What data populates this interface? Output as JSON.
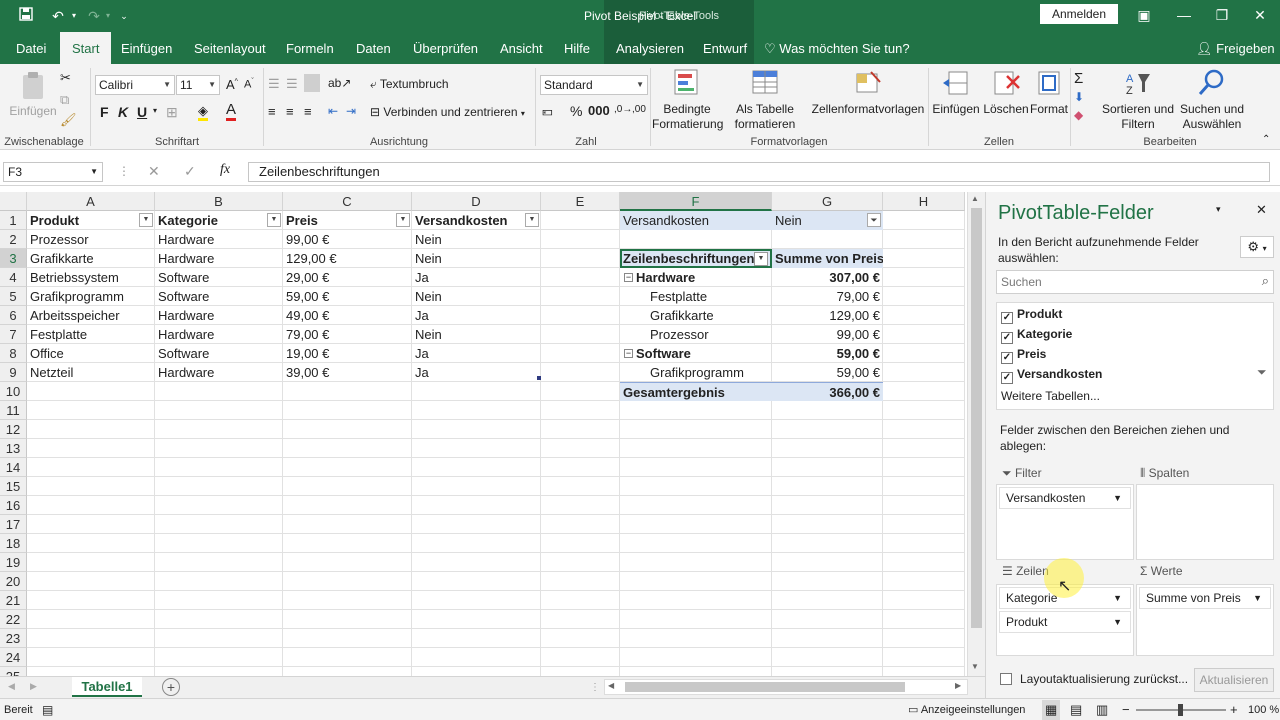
{
  "titlebar": {
    "title": "Pivot Beispiel  -  Excel",
    "context_tools": "PivotTable-Tools",
    "signin": "Anmelden"
  },
  "tabs": [
    "Datei",
    "Start",
    "Einfügen",
    "Seitenlayout",
    "Formeln",
    "Daten",
    "Überprüfen",
    "Ansicht",
    "Hilfe",
    "Analysieren",
    "Entwurf"
  ],
  "tell_me": "Was möchten Sie tun?",
  "share": "Freigeben",
  "ribbon": {
    "paste": "Einfügen",
    "clipboard": "Zwischenablage",
    "font_name": "Calibri",
    "font_size": "11",
    "bold": "F",
    "italic": "K",
    "underline": "U",
    "font_group": "Schriftart",
    "wrap": "Textumbruch",
    "merge": "Verbinden und zentrieren",
    "alignment": "Ausrichtung",
    "number_format": "Standard",
    "number": "Zahl",
    "cond_format_1": "Bedingte",
    "cond_format_2": "Formatierung",
    "as_table_1": "Als Tabelle",
    "as_table_2": "formatieren",
    "cell_styles": "Zellenformatvorlagen",
    "styles": "Formatvorlagen",
    "insert": "Einfügen",
    "delete": "Löschen",
    "format": "Format",
    "cells": "Zellen",
    "sort_1": "Sortieren und",
    "sort_2": "Filtern",
    "find_1": "Suchen und",
    "find_2": "Auswählen",
    "editing": "Bearbeiten"
  },
  "formula_bar": {
    "name_box": "F3",
    "fx": "fx",
    "formula": "Zeilenbeschriftungen"
  },
  "columns": [
    "A",
    "B",
    "C",
    "D",
    "E",
    "F",
    "G",
    "H"
  ],
  "rows": [
    "1",
    "2",
    "3",
    "4",
    "5",
    "6",
    "7",
    "8",
    "9",
    "10",
    "11",
    "12",
    "13",
    "14",
    "15",
    "16",
    "17",
    "18",
    "19",
    "20",
    "21",
    "22",
    "23",
    "24",
    "25"
  ],
  "table": {
    "headers": [
      "Produkt",
      "Kategorie",
      "Preis",
      "Versandkosten"
    ],
    "data": [
      [
        "Prozessor",
        "Hardware",
        "99,00 €",
        "Nein"
      ],
      [
        "Grafikkarte",
        "Hardware",
        "129,00 €",
        "Nein"
      ],
      [
        "Betriebssystem",
        "Software",
        "29,00 €",
        "Ja"
      ],
      [
        "Grafikprogramm",
        "Software",
        "59,00 €",
        "Nein"
      ],
      [
        "Arbeitsspeicher",
        "Hardware",
        "49,00 €",
        "Ja"
      ],
      [
        "Festplatte",
        "Hardware",
        "79,00 €",
        "Nein"
      ],
      [
        "Office",
        "Software",
        "19,00 €",
        "Ja"
      ],
      [
        "Netzteil",
        "Hardware",
        "39,00 €",
        "Ja"
      ]
    ]
  },
  "pivot": {
    "filter_field": "Versandkosten",
    "filter_value": "Nein",
    "row_label_header": "Zeilenbeschriftungen",
    "value_header": "Summe von Preis",
    "rows": [
      {
        "label": "Hardware",
        "value": "307,00 €",
        "level": 0
      },
      {
        "label": "Festplatte",
        "value": "79,00 €",
        "level": 1
      },
      {
        "label": "Grafikkarte",
        "value": "129,00 €",
        "level": 1
      },
      {
        "label": "Prozessor",
        "value": "99,00 €",
        "level": 1
      },
      {
        "label": "Software",
        "value": "59,00 €",
        "level": 0
      },
      {
        "label": "Grafikprogramm",
        "value": "59,00 €",
        "level": 1
      }
    ],
    "total_label": "Gesamtergebnis",
    "total_value": "366,00 €"
  },
  "pane": {
    "title": "PivotTable-Felder",
    "subtitle": "In den Bericht aufzunehmende Felder auswählen:",
    "search_placeholder": "Suchen",
    "fields": [
      "Produkt",
      "Kategorie",
      "Preis",
      "Versandkosten"
    ],
    "more_tables": "Weitere Tabellen...",
    "drag_hint": "Felder zwischen den Bereichen ziehen und ablegen:",
    "filter_label": "Filter",
    "columns_label": "Spalten",
    "rows_label": "Zeilen",
    "values_label": "Werte",
    "filter_items": [
      "Versandkosten"
    ],
    "row_items": [
      "Kategorie",
      "Produkt"
    ],
    "value_items": [
      "Summe von Preis"
    ],
    "defer": "Layoutaktualisierung zurückst...",
    "update": "Aktualisieren"
  },
  "sheet_tab": "Tabelle1",
  "status": {
    "ready": "Bereit",
    "display_settings": "Anzeigeeinstellungen",
    "zoom": "100 %"
  }
}
